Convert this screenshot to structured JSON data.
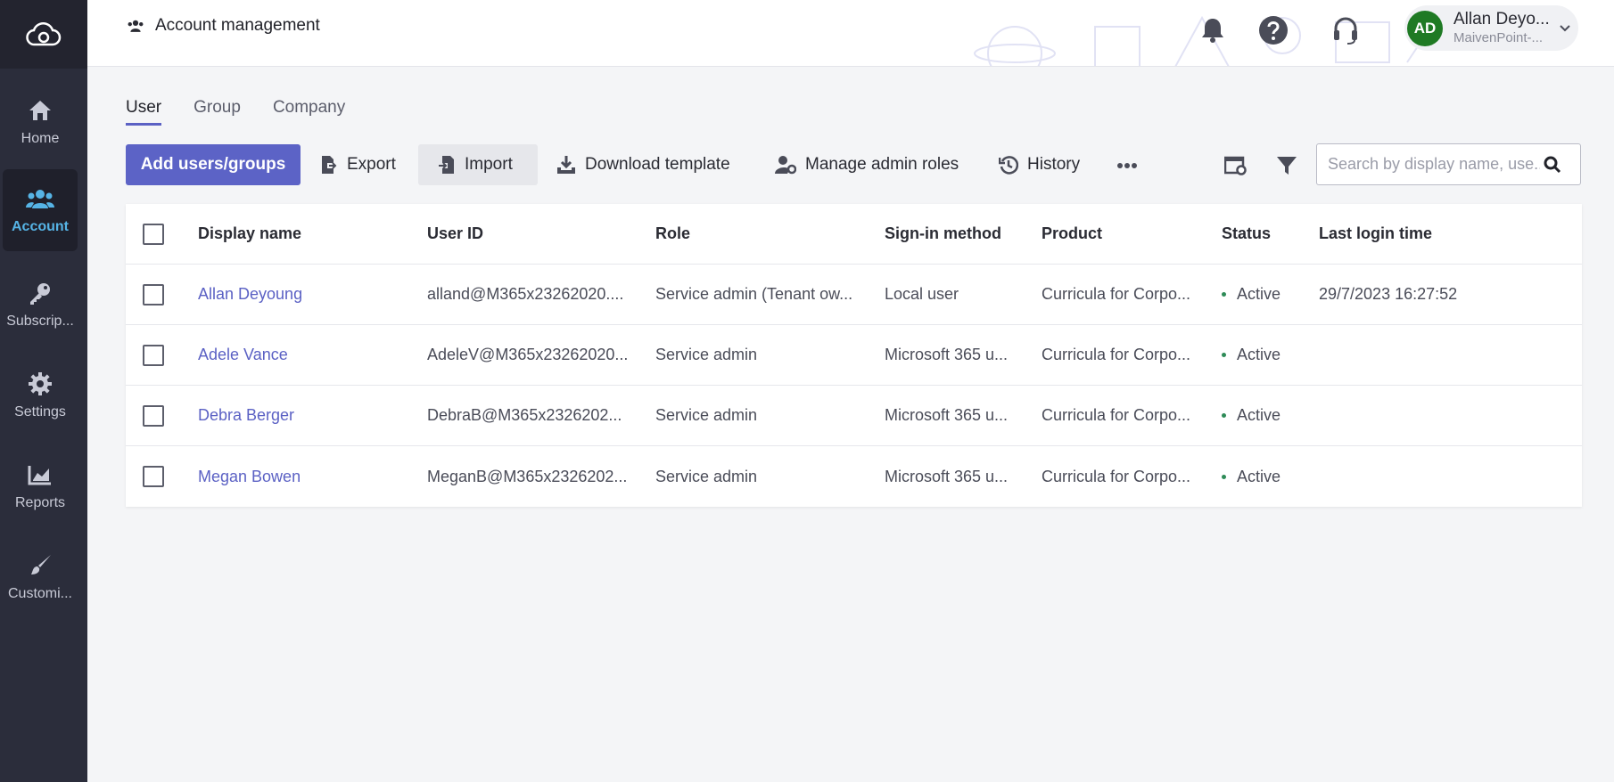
{
  "sidebar": {
    "items": [
      {
        "label": "Home",
        "icon": "home-icon"
      },
      {
        "label": "Account",
        "icon": "users-icon",
        "active": true
      },
      {
        "label": "Subscrip...",
        "icon": "key-icon"
      },
      {
        "label": "Settings",
        "icon": "gear-icon"
      },
      {
        "label": "Reports",
        "icon": "chart-icon"
      },
      {
        "label": "Customi...",
        "icon": "brush-icon"
      }
    ]
  },
  "header": {
    "title": "Account management",
    "user": {
      "initials": "AD",
      "name": "Allan Deyo...",
      "org": "MaivenPoint-..."
    }
  },
  "tabs": [
    "User",
    "Group",
    "Company"
  ],
  "toolbar": {
    "add": "Add users/groups",
    "export": "Export",
    "import": "Import",
    "download_template": "Download template",
    "manage_admin_roles": "Manage admin roles",
    "history": "History",
    "search_placeholder": "Search by display name, use..."
  },
  "table": {
    "columns": [
      "Display name",
      "User ID",
      "Role",
      "Sign-in method",
      "Product",
      "Status",
      "Last login time"
    ],
    "rows": [
      {
        "name": "Allan Deyoung",
        "user_id": "alland@M365x23262020....",
        "role": "Service admin (Tenant ow...",
        "sign_in": "Local user",
        "product": "Curricula for Corpo...",
        "status": "Active",
        "last_login": "29/7/2023 16:27:52"
      },
      {
        "name": "Adele Vance",
        "user_id": "AdeleV@M365x23262020...",
        "role": "Service admin",
        "sign_in": "Microsoft 365 u...",
        "product": "Curricula for Corpo...",
        "status": "Active",
        "last_login": ""
      },
      {
        "name": "Debra Berger",
        "user_id": "DebraB@M365x2326202...",
        "role": "Service admin",
        "sign_in": "Microsoft 365 u...",
        "product": "Curricula for Corpo...",
        "status": "Active",
        "last_login": ""
      },
      {
        "name": "Megan Bowen",
        "user_id": "MeganB@M365x2326202...",
        "role": "Service admin",
        "sign_in": "Microsoft 365 u...",
        "product": "Curricula for Corpo...",
        "status": "Active",
        "last_login": ""
      }
    ]
  },
  "colors": {
    "sidebar": "#2b2d3b",
    "accent": "#5c63c6",
    "active_nav": "#56b4e6",
    "status_active": "#2e8b57",
    "avatar": "#1f7a24"
  }
}
